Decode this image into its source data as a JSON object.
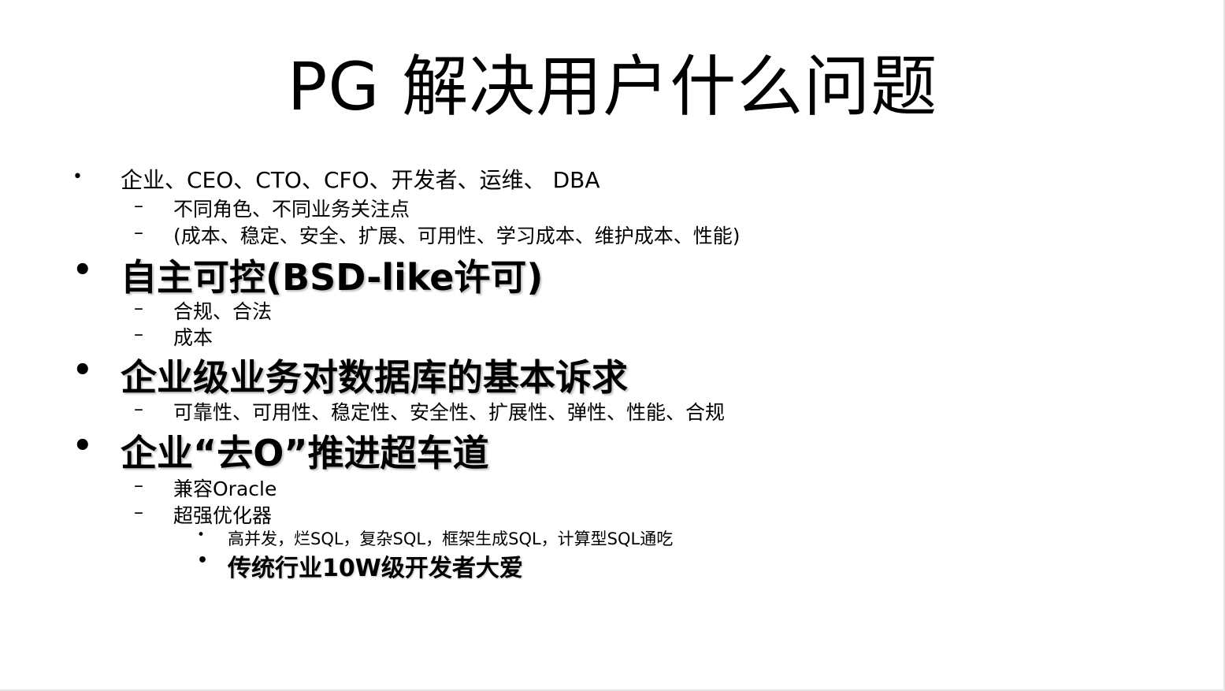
{
  "slide": {
    "title": "PG 解决用户什么问题",
    "bullet_symbol": "•",
    "dash_symbol": "–",
    "items": [
      {
        "text": "企业、CEO、CTO、CFO、开发者、运维、 DBA",
        "children": [
          {
            "text": "不同角色、不同业务关注点"
          },
          {
            "text": "(成本、稳定、安全、扩展、可用性、学习成本、维护成本、性能)"
          }
        ]
      },
      {
        "text": "自主可控(BSD-like许可)",
        "children": [
          {
            "text": "合规、合法"
          },
          {
            "text": "成本"
          }
        ]
      },
      {
        "text": "企业级业务对数据库的基本诉求",
        "children": [
          {
            "text": "可靠性、可用性、稳定性、安全性、扩展性、弹性、性能、合规"
          }
        ]
      },
      {
        "text": "企业“去O”推进超车道",
        "children": [
          {
            "text": "兼容Oracle"
          },
          {
            "text": "超强优化器",
            "children": [
              {
                "text": "高并发，烂SQL，复杂SQL，框架生成SQL，计算型SQL通吃"
              },
              {
                "text": "传统行业10W级开发者大爱"
              }
            ]
          }
        ]
      }
    ]
  }
}
